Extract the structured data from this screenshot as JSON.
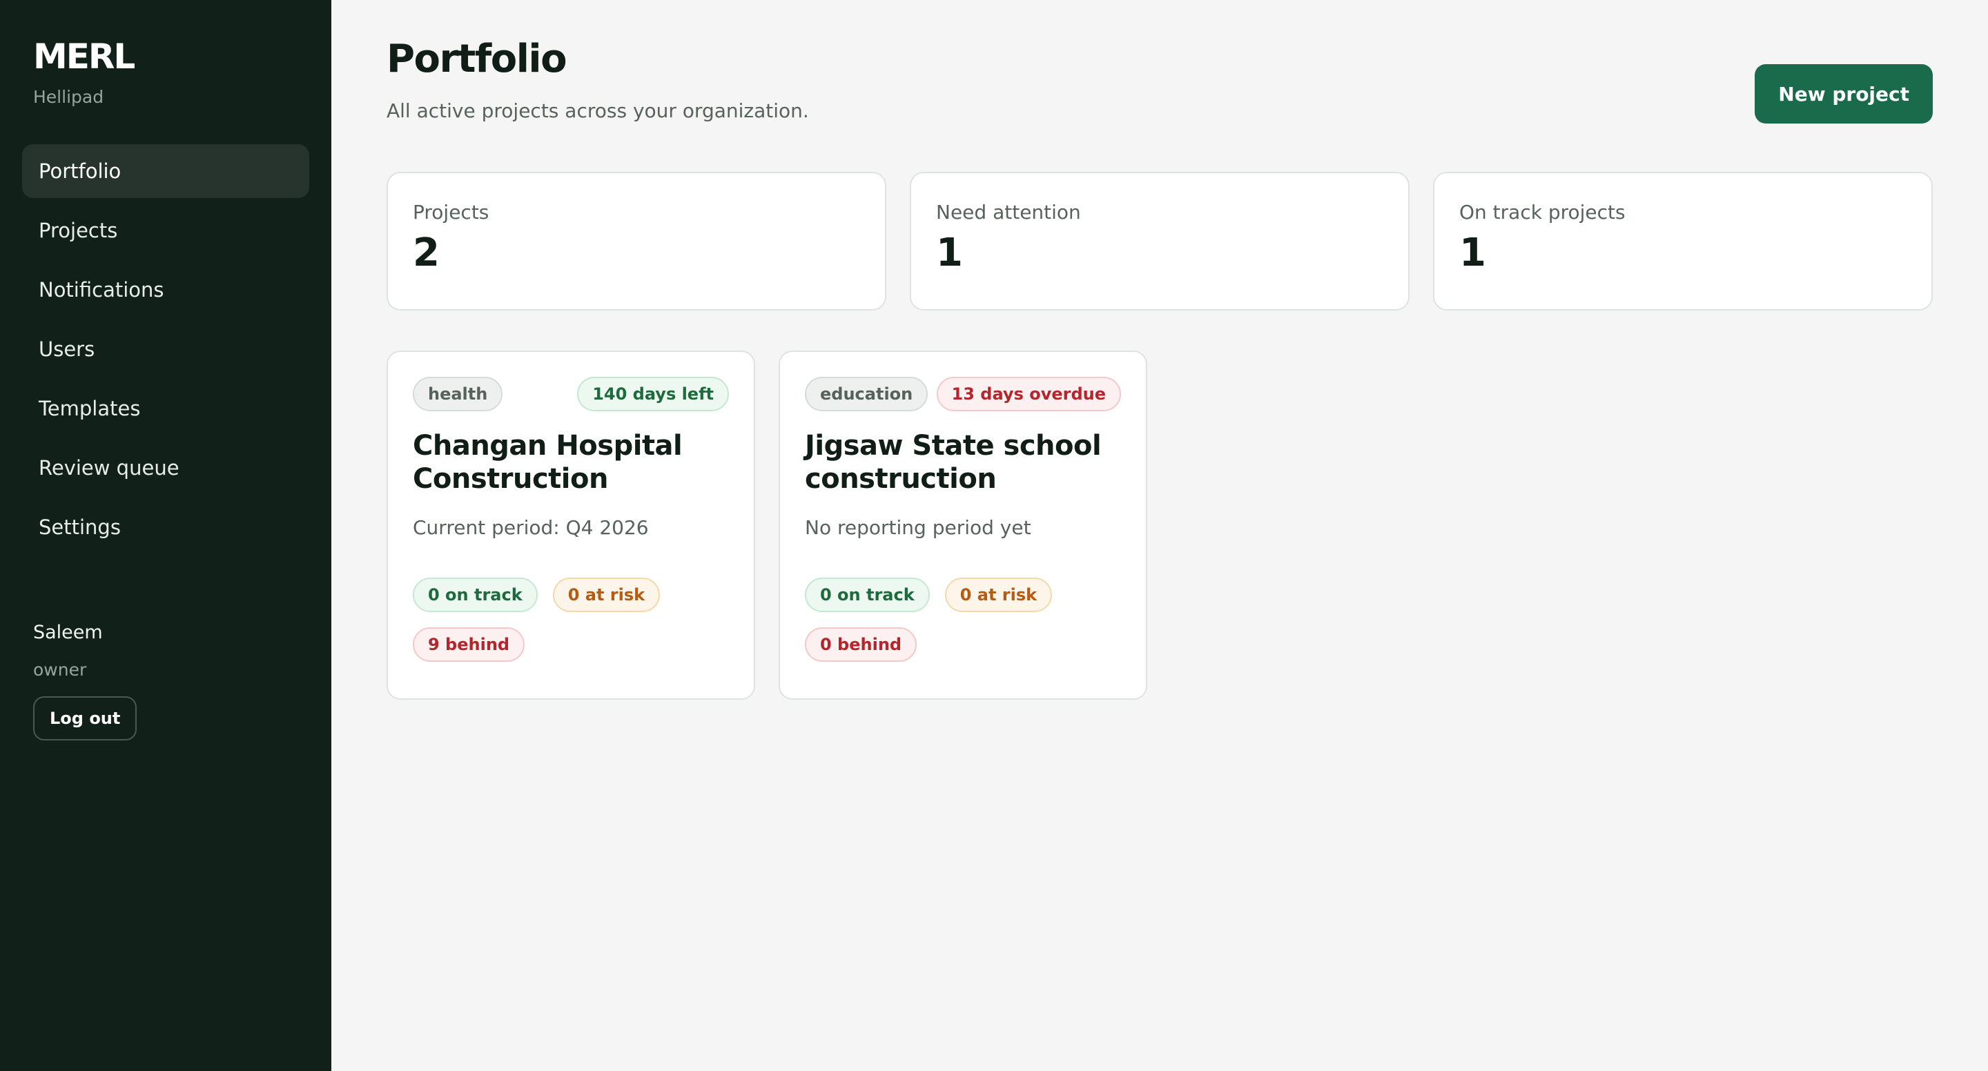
{
  "sidebar": {
    "brand": "MERL",
    "org": "Hellipad",
    "items": [
      {
        "label": "Portfolio",
        "active": true
      },
      {
        "label": "Projects"
      },
      {
        "label": "Notifications"
      },
      {
        "label": "Users"
      },
      {
        "label": "Templates"
      },
      {
        "label": "Review queue"
      },
      {
        "label": "Settings"
      }
    ],
    "user": {
      "name": "Saleem",
      "role": "owner",
      "logout_label": "Log out"
    }
  },
  "header": {
    "title": "Portfolio",
    "subtitle": "All active projects across your organization.",
    "new_project_label": "New project"
  },
  "stats": [
    {
      "label": "Projects",
      "value": "2"
    },
    {
      "label": "Need attention",
      "value": "1"
    },
    {
      "label": "On track projects",
      "value": "1"
    }
  ],
  "projects": [
    {
      "category": "health",
      "days": "140 days left",
      "title": "Changan Hospital Construction",
      "period": "Current period: Q4 2026",
      "on_track": "0 on track",
      "at_risk": "0 at risk",
      "behind": "9 behind"
    },
    {
      "category": "education",
      "days": "13 days overdue",
      "title": "Jigsaw State school construction",
      "period": "No reporting period yet",
      "on_track": "0 on track",
      "at_risk": "0 at risk",
      "behind": "0 behind"
    }
  ],
  "colors": {
    "sidebar_bg": "#12201a",
    "accent": "#1a6b4b",
    "on_track": "#1d6a3d",
    "at_risk": "#b55b12",
    "behind": "#b3262b"
  }
}
